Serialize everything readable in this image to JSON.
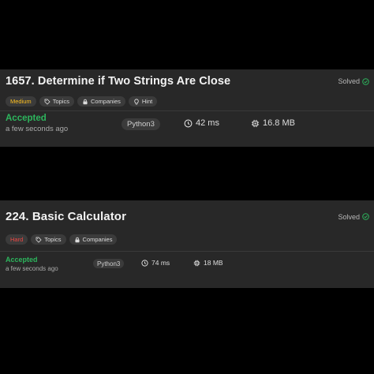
{
  "colors": {
    "background": "#000000",
    "card": "#282828",
    "accepted": "#2db55d",
    "medium": "#ffc01e",
    "hard": "#ef4743",
    "solved_check": "#2db55d"
  },
  "submissions": [
    {
      "title": "1657. Determine if Two Strings Are Close",
      "solved_label": "Solved",
      "solved_icon": "check-circle-icon",
      "tags": [
        {
          "label": "Medium",
          "icon": ""
        },
        {
          "label": "Topics",
          "icon": "tag-icon"
        },
        {
          "label": "Companies",
          "icon": "lock-icon"
        },
        {
          "label": "Hint",
          "icon": "lightbulb-icon"
        }
      ],
      "status": "Accepted",
      "time_ago": "a few seconds ago",
      "language": "Python3",
      "runtime": "42 ms",
      "runtime_icon": "clock-icon",
      "memory": "16.8 MB",
      "memory_icon": "chip-icon"
    },
    {
      "title": "224. Basic Calculator",
      "solved_label": "Solved",
      "solved_icon": "check-circle-icon",
      "tags": [
        {
          "label": "Hard",
          "icon": ""
        },
        {
          "label": "Topics",
          "icon": "tag-icon"
        },
        {
          "label": "Companies",
          "icon": "lock-icon"
        }
      ],
      "status": "Accepted",
      "time_ago": "a few seconds ago",
      "language": "Python3",
      "runtime": "74 ms",
      "runtime_icon": "clock-icon",
      "memory": "18 MB",
      "memory_icon": "chip-icon"
    }
  ]
}
